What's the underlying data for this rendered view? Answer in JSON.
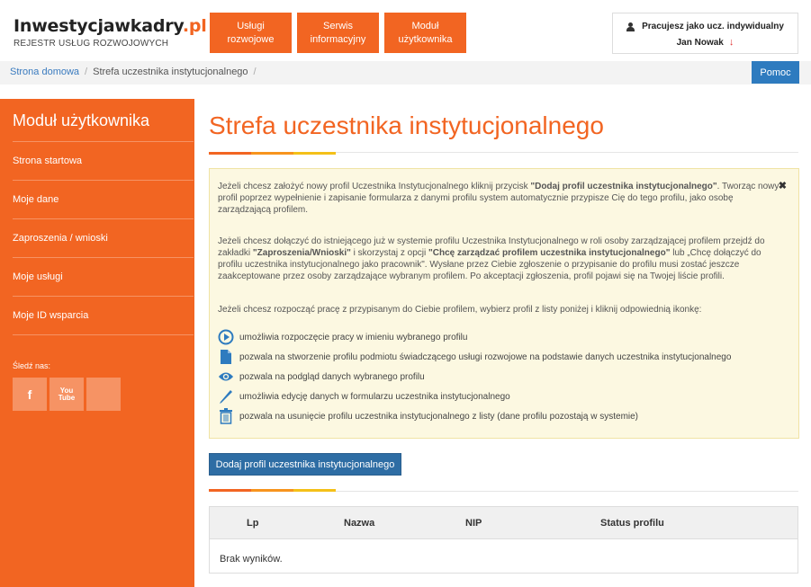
{
  "logo": {
    "brand": "Inwestycjawkadry",
    "tld": ".pl",
    "subtitle": "REJESTR USŁUG ROZWOJOWYCH"
  },
  "topnav": [
    {
      "line1": "Usługi",
      "line2": "rozwojowe"
    },
    {
      "line1": "Serwis",
      "line2": "informacyjny"
    },
    {
      "line1": "Moduł",
      "line2": "użytkownika"
    }
  ],
  "user": {
    "role": "Pracujesz jako ucz. indywidualny",
    "name": "Jan Nowak"
  },
  "breadcrumb": {
    "home": "Strona domowa",
    "current": "Strefa uczestnika instytucjonalnego",
    "sep": "/"
  },
  "help_label": "Pomoc",
  "sidebar": {
    "title": "Moduł użytkownika",
    "items": [
      {
        "label": "Strona startowa"
      },
      {
        "label": "Moje dane"
      },
      {
        "label": "Zaproszenia / wnioski"
      },
      {
        "label": "Moje usługi"
      },
      {
        "label": "Moje ID wsparcia"
      }
    ],
    "follow_label": "Śledź nas:",
    "social": {
      "facebook": "f",
      "youtube_top": "You",
      "youtube_bottom": "Tube"
    }
  },
  "main": {
    "title": "Strefa uczestnika instytucjonalnego",
    "info": {
      "p1_a": "Jeżeli chcesz założyć nowy profil Uczestnika Instytucjonalnego kliknij przycisk ",
      "p1_b": "\"Dodaj profil uczestnika instytucjonalnego\"",
      "p1_c": ". Tworząc nowy profil poprzez wypełnienie i zapisanie formularza z danymi profilu system automatycznie przypisze Cię do tego profilu, jako osobę zarządzającą profilem.",
      "p2_a": "Jeżeli chcesz dołączyć do istniejącego już w systemie profilu Uczestnika Instytucjonalnego w roli osoby zarządzającej profilem przejdź do zakładki ",
      "p2_b": "\"Zaproszenia/Wnioski\"",
      "p2_c": " i skorzystaj z opcji ",
      "p2_d": "\"Chcę zarządzać profilem uczestnika instytucjonalnego\"",
      "p2_e": " lub „Chcę dołączyć do profilu uczestnika instytucjonalnego jako pracownik\". Wysłane przez Ciebie zgłoszenie o przypisanie do profilu musi zostać jeszcze zaakceptowane przez osoby zarządzające wybranym profilem. Po akceptacji zgłoszenia, profil pojawi się na Twojej liście profili.",
      "p3": "Jeżeli chcesz rozpocząć pracę z przypisanym do Ciebie profilem, wybierz profil z listy poniżej i kliknij odpowiednią ikonkę:",
      "close": "✖",
      "legend": [
        {
          "icon": "play-icon",
          "text": "umożliwia rozpoczęcie pracy w imieniu wybranego profilu"
        },
        {
          "icon": "document-icon",
          "text": "pozwala na stworzenie profilu podmiotu świadczącego usługi rozwojowe na podstawie danych uczestnika instytucjonalnego"
        },
        {
          "icon": "eye-icon",
          "text": "pozwala na podgląd danych wybranego profilu"
        },
        {
          "icon": "pencil-icon",
          "text": "umożliwia edycję danych w formularzu uczestnika instytucjonalnego"
        },
        {
          "icon": "trash-icon",
          "text": "pozwala na usunięcie profilu uczestnika instytucjonalnego z listy (dane profilu pozostają w systemie)"
        }
      ]
    },
    "add_button": "Dodaj profil uczestnika instytucjonalnego",
    "table": {
      "columns": [
        "Lp",
        "Nazwa",
        "NIP",
        "Status profilu"
      ],
      "empty": "Brak wyników."
    }
  },
  "colors": {
    "accent": "#f26522",
    "yellow": "#f4c018",
    "blue": "#2e6da4",
    "info_bg": "#fcf8e1",
    "icon_blue": "#2e7bbf"
  }
}
